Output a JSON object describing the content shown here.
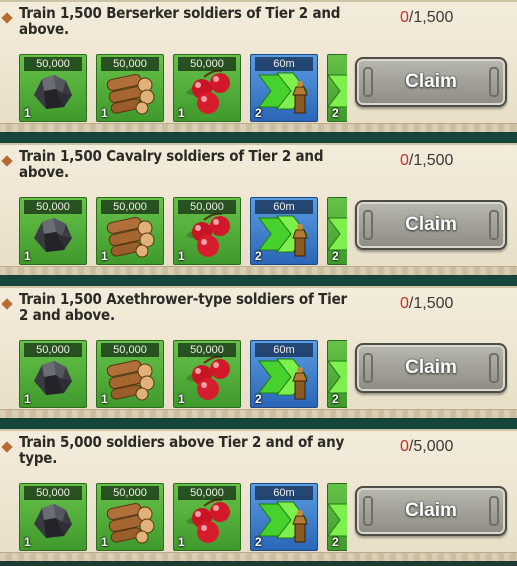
{
  "quests": [
    {
      "title": "Train 1,500 Berserker soldiers of Tier 2 and above.",
      "current": "0",
      "target": "/1,500",
      "claim_label": "Claim"
    },
    {
      "title": "Train 1,500 Cavalry soldiers of Tier 2 and above.",
      "current": "0",
      "target": "/1,500",
      "claim_label": "Claim"
    },
    {
      "title": "Train 1,500 Axethrower-type soldiers of Tier 2 and above.",
      "current": "0",
      "target": "/1,500",
      "claim_label": "Claim"
    },
    {
      "title": "Train 5,000 soldiers above Tier 2 and of any type.",
      "current": "0",
      "target": "/5,000",
      "claim_label": "Claim"
    }
  ],
  "rewards": [
    {
      "icon": "ore-icon",
      "amount": "50,000",
      "count": "1"
    },
    {
      "icon": "wood-icon",
      "amount": "50,000",
      "count": "1"
    },
    {
      "icon": "cherries-icon",
      "amount": "50,000",
      "count": "1"
    },
    {
      "icon": "speedup-arrows-icon",
      "amount": "60m",
      "count": "2"
    },
    {
      "icon": "partial-reward-icon",
      "amount": "",
      "count": "2"
    }
  ],
  "colors": {
    "progress_current": "#d22b22",
    "tile_green": "#4fae36",
    "tile_blue": "#3a7ccc"
  }
}
